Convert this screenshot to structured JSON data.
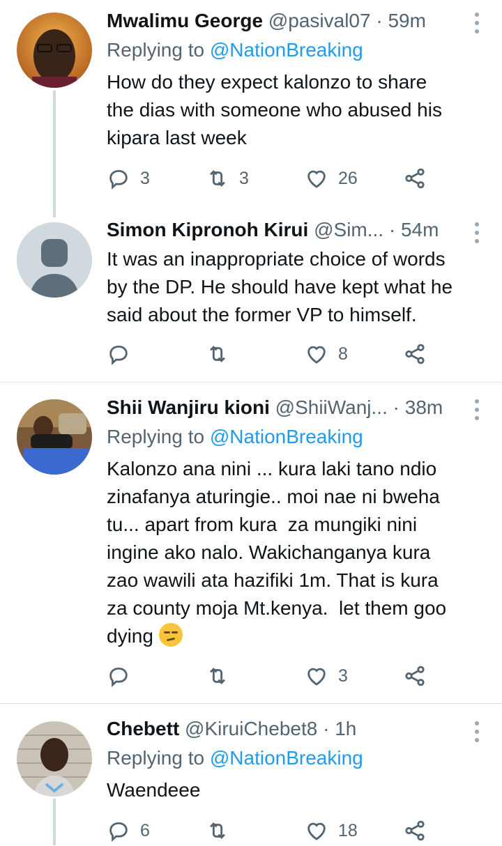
{
  "tweets": [
    {
      "name": "Mwalimu George",
      "handle": "@pasival07",
      "dot": "·",
      "time": "59m",
      "replying_prefix": "Replying to ",
      "replying_to": "@NationBreaking",
      "text": "How do they expect kalonzo to share\nthe dias with someone who abused his\nkipara last week",
      "replies": "3",
      "retweets": "3",
      "likes": "26",
      "avatar_color": "#c77a1a"
    },
    {
      "name": "Simon Kipronoh Kirui",
      "handle": "@Sim...",
      "dot": "·",
      "time": "54m",
      "text": "It was an inappropriate choice of words\nby the DP. He should have kept what he\nsaid about the former VP to himself.",
      "replies": "",
      "retweets": "",
      "likes": "8",
      "avatar_color": "#cfd9de"
    },
    {
      "name": "Shii Wanjiru kioni",
      "handle": "@ShiiWanj...",
      "dot": "·",
      "time": "38m",
      "replying_prefix": "Replying to ",
      "replying_to": "@NationBreaking",
      "text": "Kalonzo ana nini ... kura laki tano ndio\nzinafanya aturingie.. moi nae ni bweha\ntu... apart from kura  za mungiki nini\ningine ako nalo. Wakichanganya kura\nzao wawili ata hazifiki 1m. That is kura\nza county moja Mt.kenya.  let them goo\ndying",
      "emoji": "smirking-face",
      "replies": "",
      "retweets": "",
      "likes": "3",
      "avatar_color": "#3a5fa8"
    },
    {
      "name": "Chebett",
      "handle": "@KiruiChebet8",
      "dot": "·",
      "time": "1h",
      "replying_prefix": "Replying to ",
      "replying_to": "@NationBreaking",
      "text": "Waendeee",
      "replies": "6",
      "retweets": "",
      "likes": "18",
      "avatar_color": "#b9b3a8"
    }
  ],
  "icons": {
    "reply": "reply-icon",
    "retweet": "retweet-icon",
    "like": "heart-icon",
    "share": "share-icon",
    "more": "more-icon"
  },
  "colors": {
    "link": "#1d9bf0",
    "secondary_text": "#536471",
    "thread_line": "#cfd9de"
  }
}
